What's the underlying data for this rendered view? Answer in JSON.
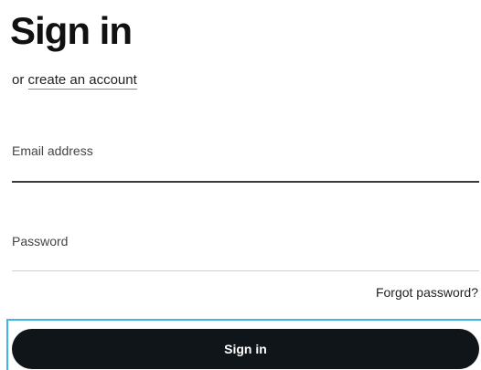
{
  "header": {
    "title": "Sign in",
    "or_text": "or",
    "create_account_link": "create an account"
  },
  "form": {
    "email_label": "Email address",
    "email_value": "",
    "password_label": "Password",
    "password_value": "",
    "forgot_password_link": "Forgot password?",
    "submit_label": "Sign in"
  },
  "colors": {
    "button_bg": "#0f1519",
    "focus_outline": "#3db6e8",
    "text": "#111111"
  }
}
